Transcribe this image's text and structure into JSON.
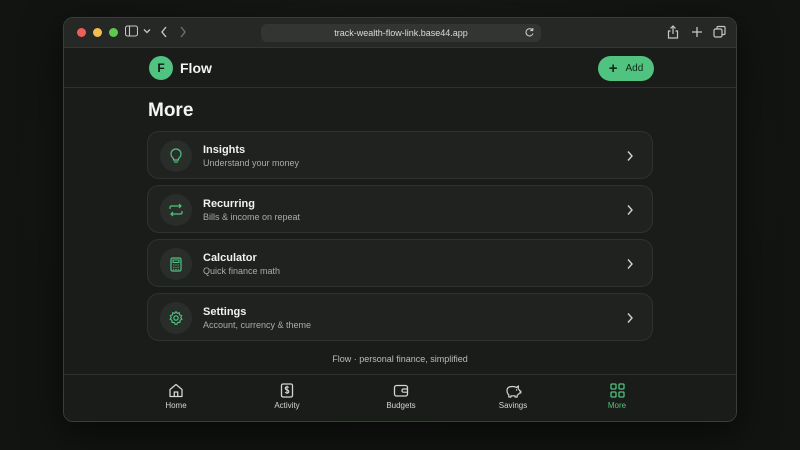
{
  "browser": {
    "url": "track-wealth-flow-link.base44.app"
  },
  "header": {
    "logo_letter": "F",
    "brand": "Flow",
    "add_label": "Add"
  },
  "page": {
    "title": "More"
  },
  "menu": [
    {
      "title": "Insights",
      "subtitle": "Understand your money",
      "icon": "lightbulb-icon"
    },
    {
      "title": "Recurring",
      "subtitle": "Bills & income on repeat",
      "icon": "repeat-icon"
    },
    {
      "title": "Calculator",
      "subtitle": "Quick finance math",
      "icon": "calculator-icon"
    },
    {
      "title": "Settings",
      "subtitle": "Account, currency & theme",
      "icon": "gear-icon"
    }
  ],
  "footer_note": "Flow · personal finance, simplified",
  "nav": [
    {
      "label": "Home",
      "icon": "home-icon",
      "active": false
    },
    {
      "label": "Activity",
      "icon": "receipt-icon",
      "active": false
    },
    {
      "label": "Budgets",
      "icon": "wallet-icon",
      "active": false
    },
    {
      "label": "Savings",
      "icon": "piggy-bank-icon",
      "active": false
    },
    {
      "label": "More",
      "icon": "grid-icon",
      "active": true
    }
  ],
  "colors": {
    "accent": "#4fc37f",
    "background": "#1a1c1a",
    "card": "#1f221f"
  }
}
